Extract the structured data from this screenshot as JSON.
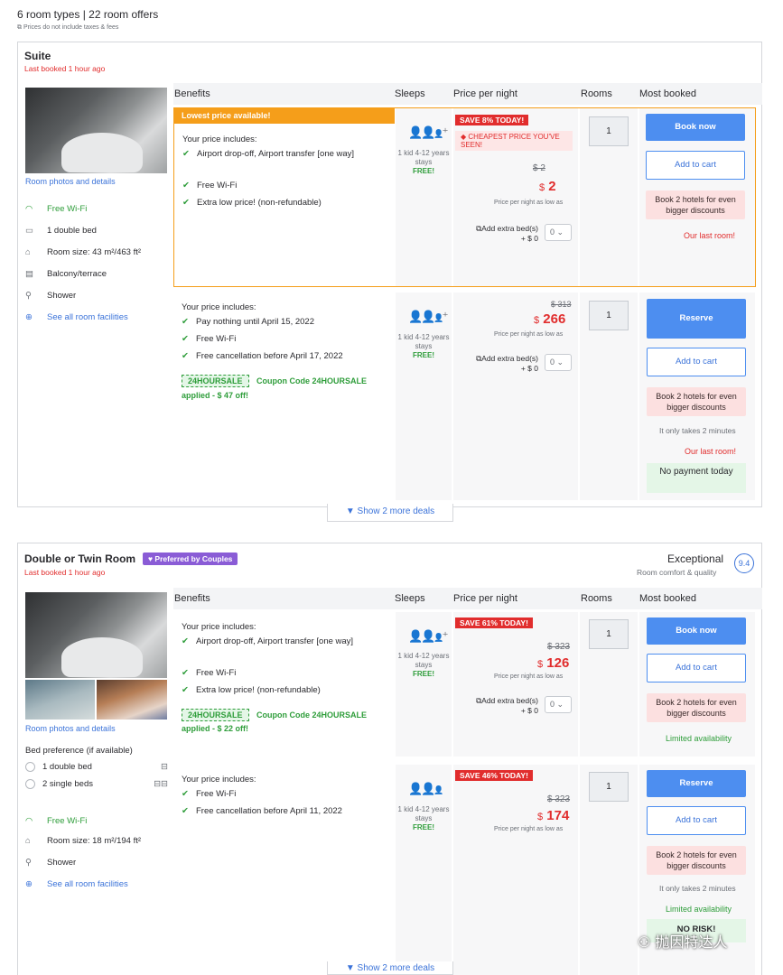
{
  "summary": {
    "title": "6 room types | 22 room offers",
    "note": "Prices do not include taxes & fees"
  },
  "columns": {
    "benefits": "Benefits",
    "sleeps": "Sleeps",
    "price": "Price per night",
    "rooms": "Rooms",
    "most": "Most booked"
  },
  "suite": {
    "name": "Suite",
    "last_booked": "Last booked 1 hour ago",
    "photos_link": "Room photos and details",
    "facilities": [
      "Free Wi-Fi",
      "1 double bed",
      "Room size: 43 m²/463 ft²",
      "Balcony/terrace",
      "Shower"
    ],
    "see_all": "See all room facilities",
    "offer1": {
      "banner": "Lowest price available!",
      "includes": "Your price includes:",
      "items": [
        "Airport drop-off, Airport transfer [one way]",
        "Free Wi-Fi",
        "Extra low price! (non-refundable)"
      ],
      "sleeps": "1 kid 4-12 years stays",
      "free": "FREE!",
      "save": "SAVE 8% TODAY!",
      "cheapest": "CHEAPEST PRICE YOU'VE SEEN!",
      "old_price": "$ 2",
      "currency": "$",
      "price": "2",
      "per_night": "Price per night as low as",
      "extra_bed": "Add extra bed(s)",
      "extra_bed_price": "+ $ 0",
      "extra_bed_qty": "0",
      "rooms": "1",
      "book": "Book now",
      "cart": "Add to cart",
      "promo": "Book 2 hotels for even bigger discounts",
      "status": "Our last room!"
    },
    "offer2": {
      "includes": "Your price includes:",
      "items": [
        "Pay nothing until April 15, 2022",
        "Free Wi-Fi",
        "Free cancellation before April 17, 2022"
      ],
      "coupon": "24HOURSALE",
      "coupon_text": "Coupon Code 24HOURSALE",
      "applied": "applied - $ 47 off!",
      "sleeps": "1 kid 4-12 years stays",
      "free": "FREE!",
      "old_price": "$ 313",
      "currency": "$",
      "price": "266",
      "per_night": "Price per night as low as",
      "extra_bed": "Add extra bed(s)",
      "extra_bed_price": "+ $ 0",
      "extra_bed_qty": "0",
      "rooms": "1",
      "book": "Reserve",
      "cart": "Add to cart",
      "promo": "Book 2 hotels for even bigger discounts",
      "takes": "It only takes 2 minutes",
      "status": "Our last room!",
      "nopay": "No payment today"
    },
    "show_more": "Show 2 more deals"
  },
  "double": {
    "name": "Double or Twin Room",
    "badge": "Preferred by Couples",
    "last_booked": "Last booked 1 hour ago",
    "rating_label": "Exceptional",
    "rating_sub": "Room comfort & quality",
    "rating": "9.4",
    "photos_link": "Room photos and details",
    "bed_pref": "Bed preference (if available)",
    "beds": [
      "1 double bed",
      "2 single beds"
    ],
    "facilities": [
      "Free Wi-Fi",
      "Room size: 18 m²/194 ft²",
      "Shower"
    ],
    "see_all": "See all room facilities",
    "offer1": {
      "includes": "Your price includes:",
      "items": [
        "Airport drop-off, Airport transfer [one way]",
        "Free Wi-Fi",
        "Extra low price! (non-refundable)"
      ],
      "coupon": "24HOURSALE",
      "coupon_text": "Coupon Code 24HOURSALE",
      "applied": "applied - $ 22 off!",
      "sleeps": "1 kid 4-12 years stays",
      "free": "FREE!",
      "save": "SAVE 61% TODAY!",
      "old_price": "$ 323",
      "currency": "$",
      "price": "126",
      "per_night": "Price per night as low as",
      "extra_bed": "Add extra bed(s)",
      "extra_bed_price": "+ $ 0",
      "extra_bed_qty": "0",
      "rooms": "1",
      "book": "Book now",
      "cart": "Add to cart",
      "promo": "Book 2 hotels for even bigger discounts",
      "status": "Limited availability"
    },
    "offer2": {
      "includes": "Your price includes:",
      "items": [
        "Free Wi-Fi",
        "Free cancellation before April 11, 2022"
      ],
      "sleeps": "1 kid 4-12 years stays",
      "free": "FREE!",
      "save": "SAVE 46% TODAY!",
      "old_price": "$ 323",
      "currency": "$",
      "price": "174",
      "per_night": "Price per night as low as",
      "rooms": "1",
      "book": "Reserve",
      "cart": "Add to cart",
      "promo": "Book 2 hotels for even bigger discounts",
      "takes": "It only takes 2 minutes",
      "status": "Limited availability",
      "norisk": "NO RISK!"
    },
    "show_more": "Show 2 more deals"
  },
  "watermark": "抛因特达人"
}
